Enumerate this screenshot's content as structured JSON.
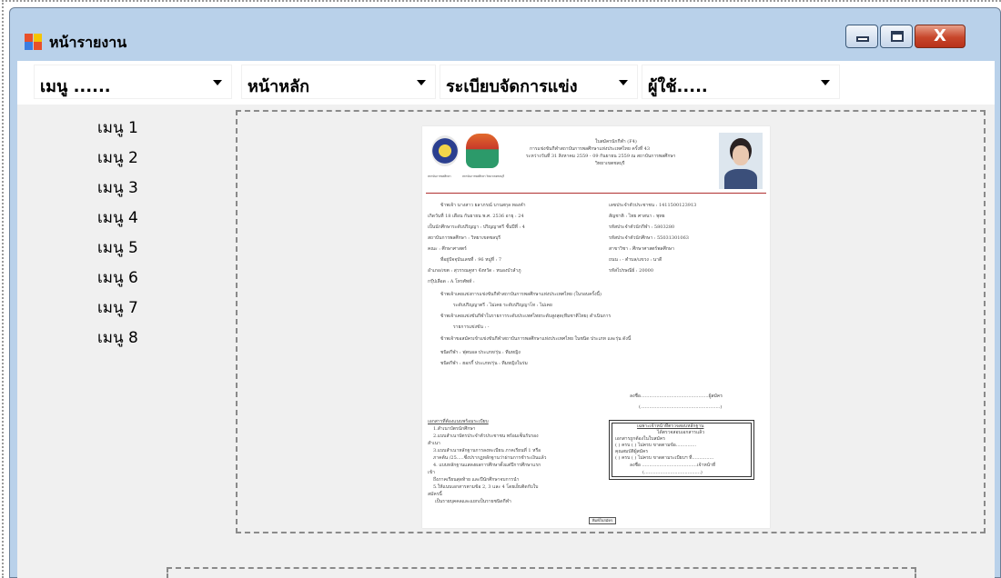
{
  "window": {
    "title": "หน้ารายงาน",
    "controls": [
      "minimize",
      "maximize",
      "close"
    ],
    "close_glyph": "X"
  },
  "menubar": [
    {
      "label": "เมนู ......"
    },
    {
      "label": "หน้าหลัก"
    },
    {
      "label": "ระเบียบจัดการแข่ง"
    },
    {
      "label": "ผู้ใช้....."
    }
  ],
  "sidebar": {
    "items": [
      "เมนู 1",
      "เมนู 2",
      "เมนู 3",
      "เมนู 4",
      "เมนู 5",
      "เมนู 6",
      "เมนู 7",
      "เมนู 8"
    ]
  },
  "report": {
    "doc_title": "ใบสมัครนักกีฬา (F4)",
    "doc_sub1": "การแข่งขันกีฬาสถาบันการพลศึกษาแห่งประเทศไทย ครั้งที่ 43",
    "doc_sub2": "ระหว่างวันที่ 31 สิงหาคม 2559 - 09 กันยายน 2559 ณ สถาบันการพลศึกษา",
    "doc_sub3": "วิทยาเขตชลบุรี",
    "logo_caption_left": "สถาบันการพลศึกษา",
    "logo_caption_right": "สถาบันการพลศึกษา วิทยาเขตชลบุรี",
    "lines_left": [
      "ข้าพเจ้า  นางสาว  ยลาภรณ์  บานสกุล  ทองคำ",
      "เกิดวันที่  18    เดือน  กันยายน   พ.ศ. 2536  อายุ  :  24",
      "เป็นนักศึกษาระดับปริญญา  :   ปริญญาตรี     ชั้นปีที่   :  4",
      "สถาบันการพลศึกษา  :   วิทยาเขตชลบุรี",
      "คณะ  :  ศึกษาศาสตร์",
      "ที่อยู่ปัจจุบันเลขที่  :   96        หมู่ที่  :  7",
      "อำเภอ/เขต  :  สุวรรณคูหา         จังหวัด  :  หนองบัวลำภู",
      "กรุ๊ปเลือด  :  A                       โทรศัพท์  :"
    ],
    "lines_right": [
      "เลขประจำตัวประชาชน : 1411500123913",
      "สัญชาติ  :  ไทย     ศาสนา  :  พุทธ",
      "รหัสประจำตัวนักกีฬา  :  5803280",
      "รหัสประจำตัวนักศึกษา  :  55031301063",
      "สาขาวิชา  :  ศึกษาศาสตร์พลศึกษา",
      "ถนน  :  -      ตำบล/แขวง  :  นาดี",
      "รหัสไปรษณีย์  :  20000"
    ],
    "lines_mid": [
      "ข้าพเจ้าเคยแข่งการแข่งขันกีฬาสถาบันการพลศึกษาแห่งประเทศไทย (ในรอบครั้งนี้)",
      "ระดับปริญญาตรี  :  ไม่เคย                         ระดับปริญญาโท  :  ไม่เคย",
      "ข้าพเจ้าเคยแข่งขันกีฬาในรายการระดับประเทศไทยระดับสูงสุด(ทีมชาติไทย) ดำเนินการ",
      "รายการแข่งขัน  :  -",
      "ข้าพเจ้าขอสมัครเข้าแข่งขันกีฬาสถาบันการพลศึกษาแห่งประเทศไทย ในชนิด ประเภท และรุ่น ดังนี้",
      "ชนิดกีฬา : ฟุตบอล                   ประเภท/รุ่น : ทีมหญิง",
      "ชนิดกีฬา : ฮอกกี้                     ประเภท/รุ่น : ทีมหญิงในร่ม"
    ],
    "sign_line1": "ลงชื่อ...............................................ผู้สมัคร",
    "sign_line2": "(.......................................................)",
    "docs_heading": "เอกสารที่ต้องแนบพร้อมระเบียบ",
    "docs_lines": [
      "1.สำเนาบัตรนักศึกษา",
      "2.แบบสำเนาบัตรประจำตัวประชาชน พร้อมเซ็นรับรอง",
      "สำเนา",
      "3.แบบสำเนาหลักฐานการลงทะเบียน ภาคเรียนที่ 1 หรือ",
      "ภาคต้น /25.....ซึ่งปรากฏหลักฐานว่าผ่านการชำระเงินแล้ว",
      "4. แบบหลักฐานแสดงผลการศึกษาตั้งแต่ปีการศึกษาแรก",
      "เข้า",
      "ถึงภาคเรียนสุดท้าย และปีนักศึกษาจบการนำ",
      "5.ให้แนบเอกสารตามข้อ 2, 3 และ 4 โดยเย็บติดกับใบ",
      "สมัครนี้",
      "เป็นรายบุคคลและแยกเป็นรายชนิดกีฬา"
    ],
    "officer_heading": "เฉพาะเจ้าหน้าที่ตรวจสอบหลักฐาน",
    "officer_lines": [
      "ได้ตรวจสอบเอกสารแล้ว",
      "เอกสารถูกต้องในใบสมัคร",
      "( ) ครบ  ( ) ไม่ครบ ขาดตามข้อ..............",
      "คุณสมบัติผู้สมัคร",
      "( ) ครบ  ( ) ไม่ครบ ขาดตามระเบียบฯ ที่...............",
      "ลงชื่อ ......................................เจ้าหน้าที่",
      "(.......................................)"
    ],
    "print_button": "พิมพ์ใบสมัคร"
  },
  "colors": {
    "title_bar": "#b9d1ea",
    "client_bg": "#f0f0f0",
    "close_button": "#c7462b",
    "divider_red": "#b03030"
  }
}
